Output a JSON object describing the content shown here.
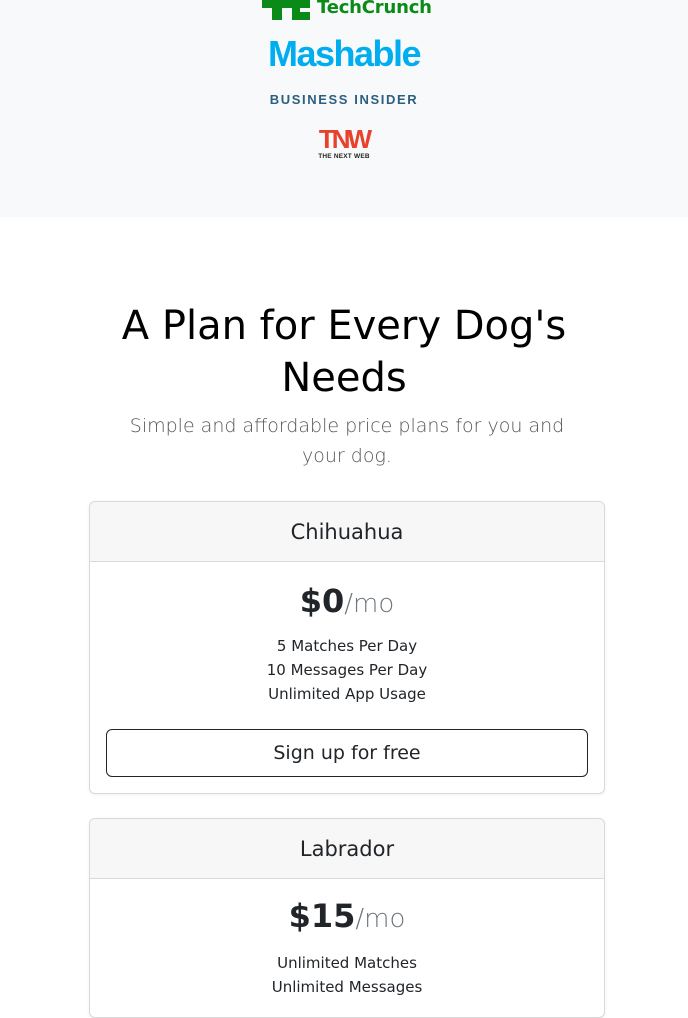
{
  "press": {
    "logos": {
      "techcrunch": "TechCrunch",
      "mashable": "Mashable",
      "business_insider": "BUSINESS INSIDER",
      "tnw": "TNW",
      "tnw_sub": "THE NEXT WEB"
    },
    "colors": {
      "techcrunch": "#0a8a16",
      "mashable": "#00aeef",
      "business_insider": "#2c5f7f",
      "tnw": "#e8412c"
    }
  },
  "pricing": {
    "heading_line1": "A Plan for Every Dog's",
    "heading_line2": "Needs",
    "subtitle": "Simple and affordable price plans for you and your dog.",
    "plans": [
      {
        "name": "Chihuahua",
        "price": "$0",
        "period": "/mo",
        "features": [
          "5 Matches Per Day",
          "10 Messages Per Day",
          "Unlimited App Usage"
        ],
        "button": "Sign up for free"
      },
      {
        "name": "Labrador",
        "price": "$15",
        "period": "/mo",
        "features": [
          "Unlimited Matches",
          "Unlimited Messages"
        ]
      }
    ]
  }
}
